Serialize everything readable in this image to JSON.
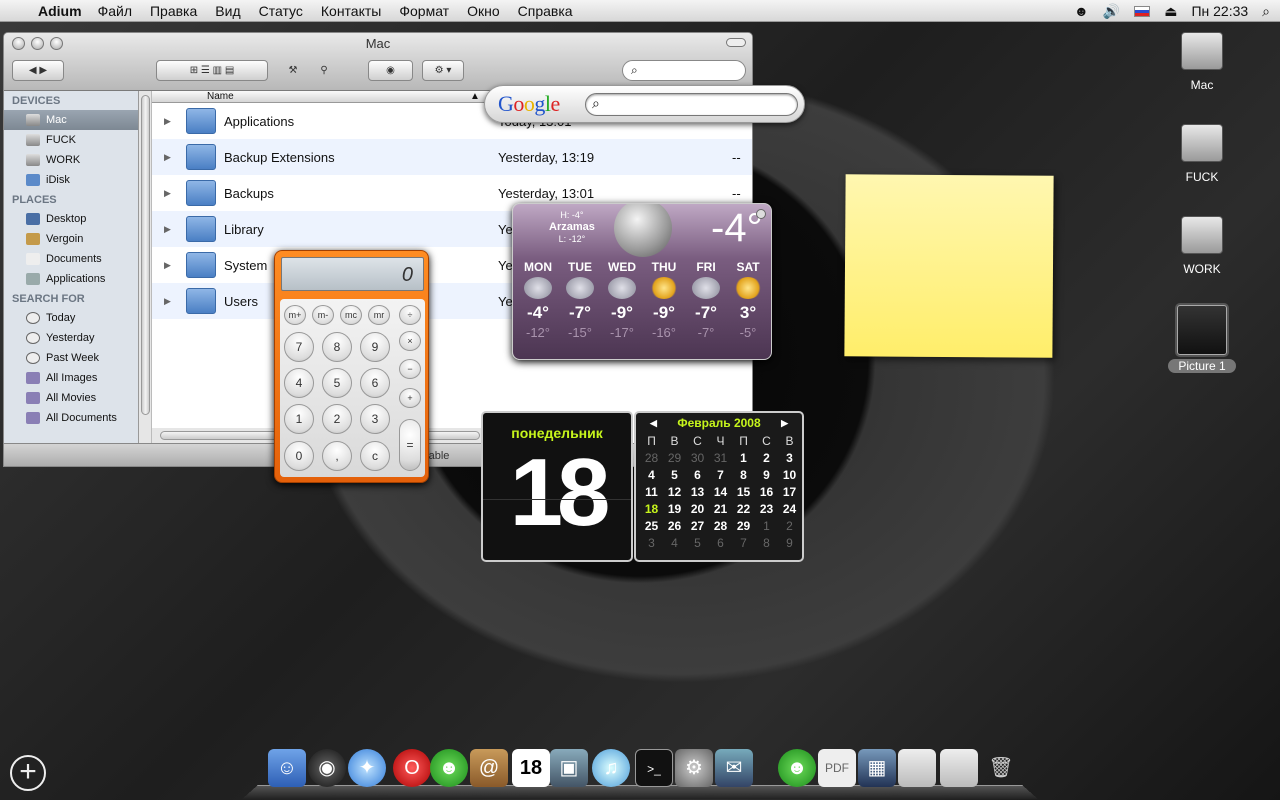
{
  "menubar": {
    "app": "Adium",
    "items": [
      "Файл",
      "Правка",
      "Вид",
      "Статус",
      "Контакты",
      "Формат",
      "Окно",
      "Справка"
    ],
    "clock": "Пн 22:33"
  },
  "finder": {
    "title": "Mac",
    "column_name": "Name",
    "sidebar": {
      "devices_label": "DEVICES",
      "devices": [
        "Mac",
        "FUCK",
        "WORK",
        "iDisk"
      ],
      "places_label": "PLACES",
      "places": [
        "Desktop",
        "Vergoin",
        "Documents",
        "Applications"
      ],
      "search_label": "SEARCH FOR",
      "search": [
        "Today",
        "Yesterday",
        "Past Week",
        "All Images",
        "All Movies",
        "All Documents"
      ]
    },
    "rows": [
      {
        "name": "Applications",
        "date": "Today, 13:01",
        "size": ""
      },
      {
        "name": "Backup Extensions",
        "date": "Yesterday, 13:19",
        "size": "--"
      },
      {
        "name": "Backups",
        "date": "Yesterday, 13:01",
        "size": "--"
      },
      {
        "name": "Library",
        "date": "Yes",
        "size": ""
      },
      {
        "name": "System",
        "date": "Yes",
        "size": ""
      },
      {
        "name": "Users",
        "date": "Yes",
        "size": ""
      }
    ],
    "status": "able"
  },
  "google": {
    "logo": "Google"
  },
  "weather": {
    "city": "Arzamas",
    "high": "H: -4°",
    "low": "L: -12°",
    "current": "-4°",
    "days": [
      {
        "day": "MON",
        "hi": "-4°",
        "lo": "-12°",
        "icon": "snow-icon"
      },
      {
        "day": "TUE",
        "hi": "-7°",
        "lo": "-15°",
        "icon": "snow-icon"
      },
      {
        "day": "WED",
        "hi": "-9°",
        "lo": "-17°",
        "icon": "snow-icon"
      },
      {
        "day": "THU",
        "hi": "-9°",
        "lo": "-16°",
        "icon": "sun-icon"
      },
      {
        "day": "FRI",
        "hi": "-7°",
        "lo": "-7°",
        "icon": "snow-icon"
      },
      {
        "day": "SAT",
        "hi": "3°",
        "lo": "-5°",
        "icon": "sun-icon"
      }
    ]
  },
  "calculator": {
    "display": "0",
    "keys": {
      "mplus": "m+",
      "mminus": "m-",
      "mc": "mc",
      "mr": "mr",
      "div": "÷",
      "mul": "×",
      "minus": "−",
      "plus": "+",
      "eq": "=",
      "k7": "7",
      "k8": "8",
      "k9": "9",
      "k4": "4",
      "k5": "5",
      "k6": "6",
      "k1": "1",
      "k2": "2",
      "k3": "3",
      "k0": "0",
      "dot": ",",
      "c": "c"
    }
  },
  "flipclock": {
    "dayname": "понедельник",
    "day": "18"
  },
  "calendar": {
    "month": "Февраль 2008",
    "weekdays": [
      "П",
      "В",
      "С",
      "Ч",
      "П",
      "С",
      "В"
    ],
    "weeks": [
      [
        "28",
        "29",
        "30",
        "31",
        "1",
        "2",
        "3"
      ],
      [
        "4",
        "5",
        "6",
        "7",
        "8",
        "9",
        "10"
      ],
      [
        "11",
        "12",
        "13",
        "14",
        "15",
        "16",
        "17"
      ],
      [
        "18",
        "19",
        "20",
        "21",
        "22",
        "23",
        "24"
      ],
      [
        "25",
        "26",
        "27",
        "28",
        "29",
        "1",
        "2"
      ],
      [
        "3",
        "4",
        "5",
        "6",
        "7",
        "8",
        "9"
      ]
    ]
  },
  "desktop": {
    "icons": [
      "Mac",
      "FUCK",
      "WORK"
    ],
    "picture": "Picture 1"
  }
}
